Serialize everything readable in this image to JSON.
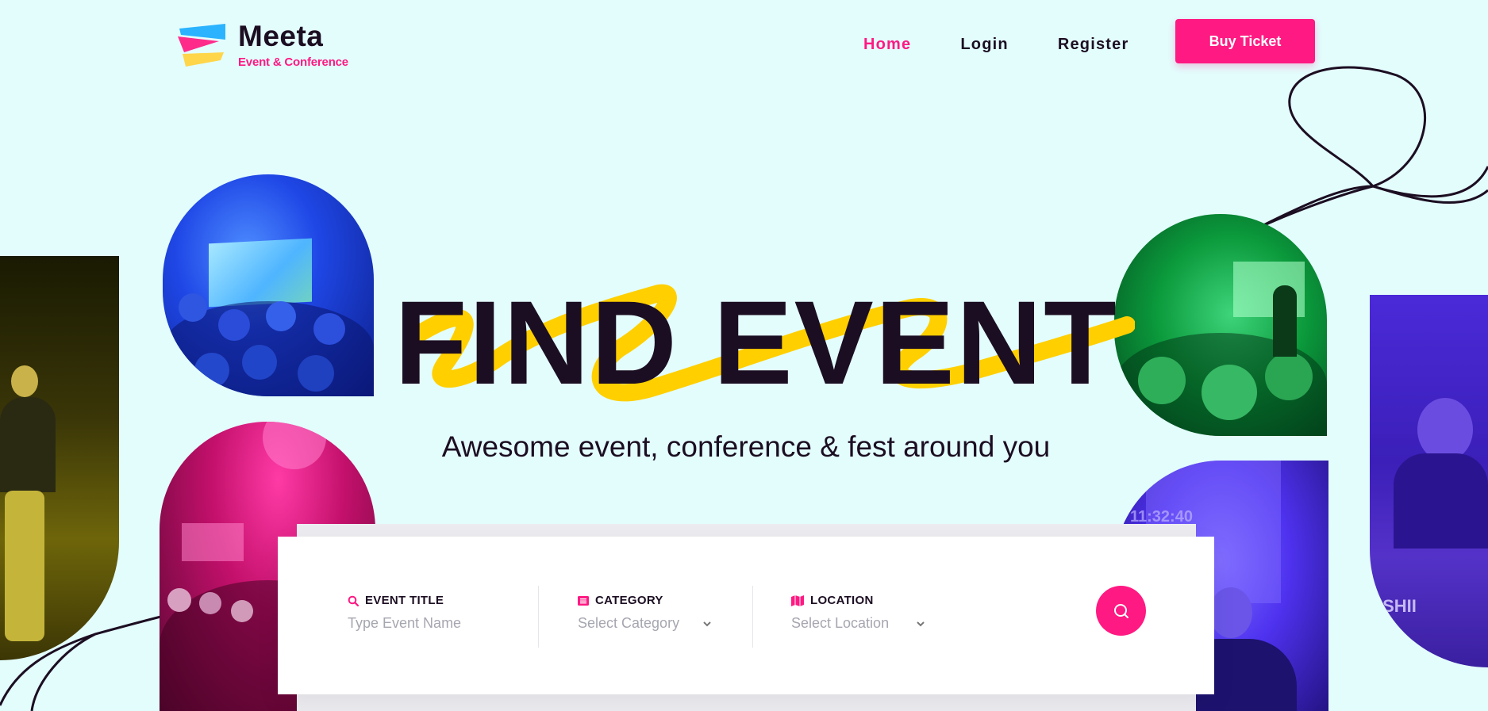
{
  "brand": {
    "name": "Meeta",
    "tagline": "Event & Conference"
  },
  "nav": {
    "items": [
      {
        "label": "Home",
        "active": true
      },
      {
        "label": "Login",
        "active": false
      },
      {
        "label": "Register",
        "active": false
      }
    ]
  },
  "header": {
    "cta_label": "Buy Ticket"
  },
  "hero": {
    "title": "FIND EVENT",
    "subtitle": "Awesome event, conference & fest around you"
  },
  "search": {
    "event_title": {
      "label": "EVENT TITLE",
      "placeholder": "Type Event Name"
    },
    "category": {
      "label": "CATEGORY",
      "placeholder": "Select Category"
    },
    "location": {
      "label": "LOCATION",
      "placeholder": "Select Location"
    }
  },
  "photos": {
    "violet_overlay_text": "11:32:40",
    "purple_overlay_text": "ISHII"
  },
  "colors": {
    "accent": "#ff1982",
    "background": "#e3fdfd",
    "text": "#1c0e22",
    "highlight": "#ffcf00"
  },
  "icons": [
    "logo-flag-icon",
    "search-icon",
    "list-icon",
    "map-icon",
    "chevron-down-icon"
  ]
}
